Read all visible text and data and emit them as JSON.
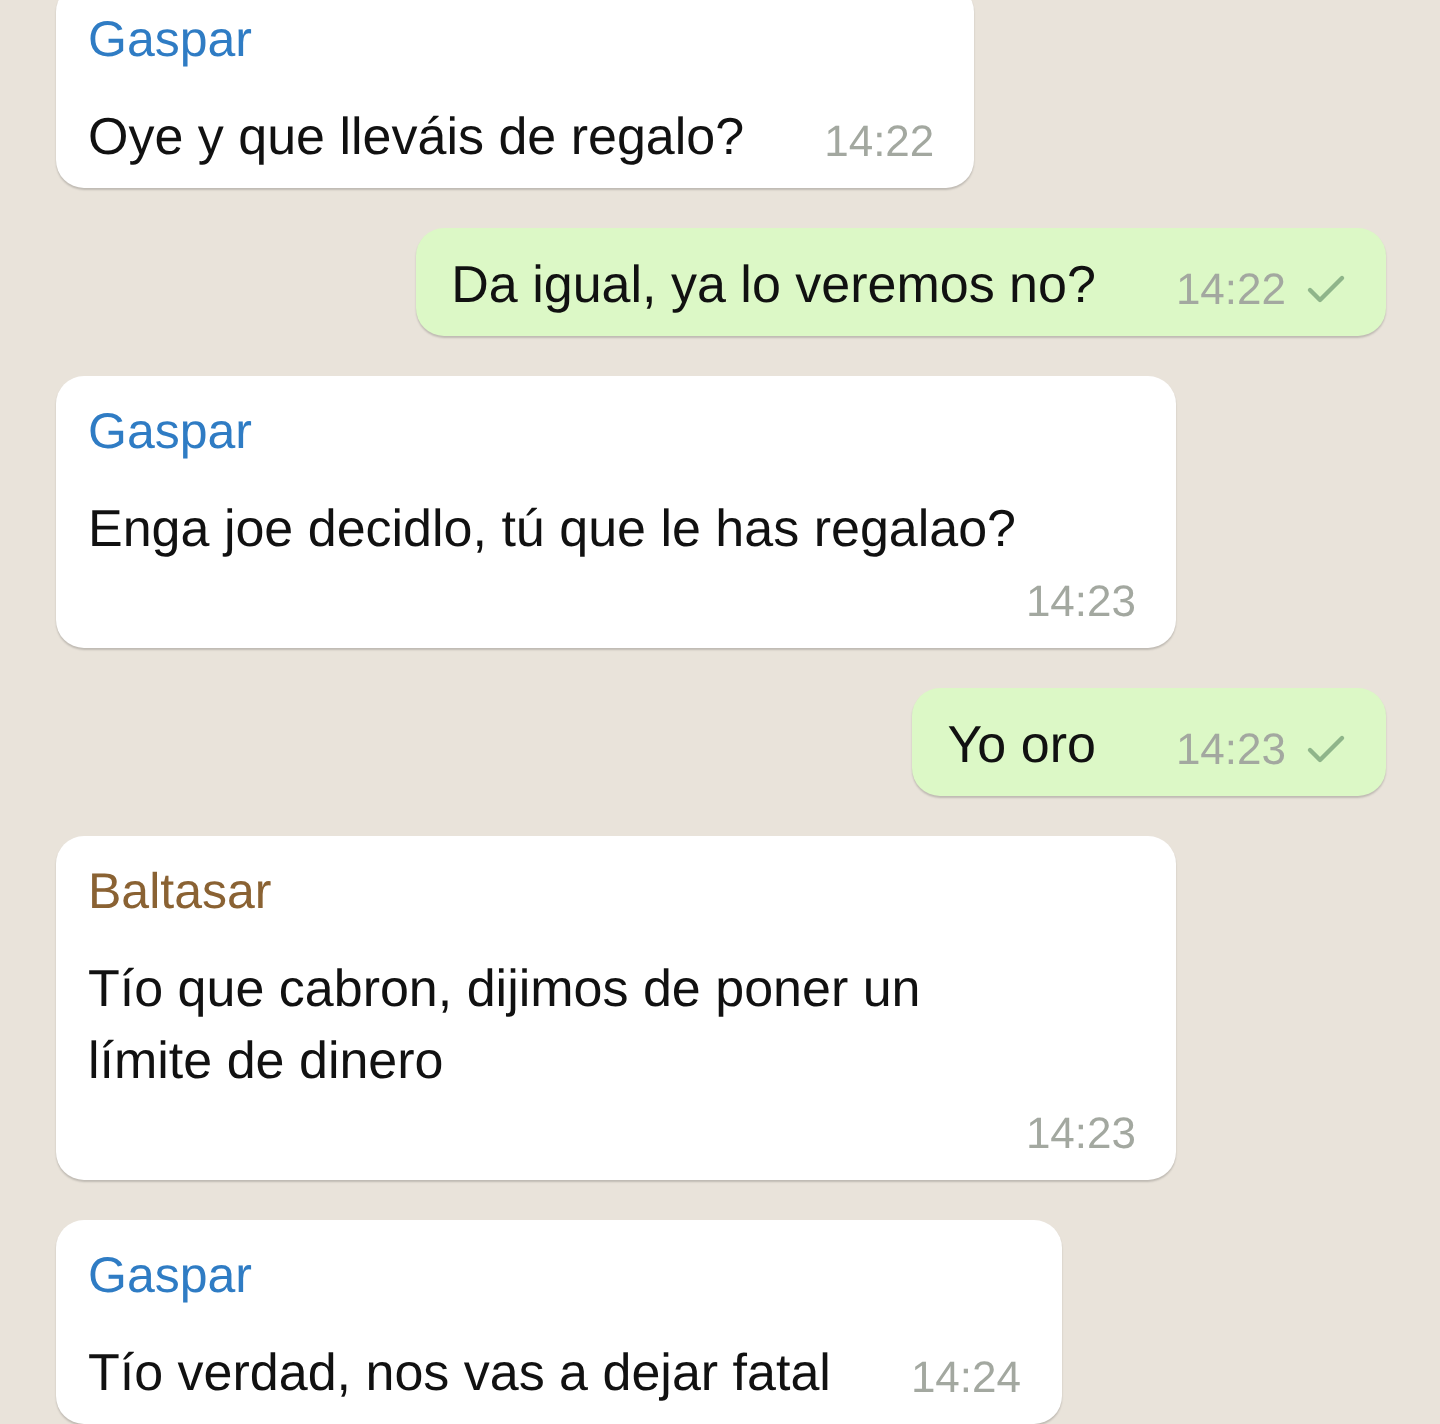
{
  "messages": [
    {
      "kind": "incoming",
      "sender": "Gaspar",
      "color": "#2f7cc4",
      "text": "Oye y que lleváis de regalo?",
      "time": "14:22"
    },
    {
      "kind": "outgoing",
      "text": "Da igual, ya lo veremos no?",
      "time": "14:22",
      "delivered": true
    },
    {
      "kind": "incoming",
      "sender": "Gaspar",
      "color": "#2f7cc4",
      "text": "Enga joe decidlo, tú que le has regalao?",
      "time": "14:23"
    },
    {
      "kind": "outgoing",
      "text": "Yo oro",
      "time": "14:23",
      "delivered": true
    },
    {
      "kind": "incoming",
      "sender": "Baltasar",
      "color": "#8a6233",
      "text": "Tío que cabron, dijimos de poner un límite de dinero",
      "time": "14:23"
    },
    {
      "kind": "incoming",
      "sender": "Gaspar",
      "color": "#2f7cc4",
      "text": "Tío verdad, nos vas a dejar fatal",
      "time": "14:24"
    }
  ]
}
